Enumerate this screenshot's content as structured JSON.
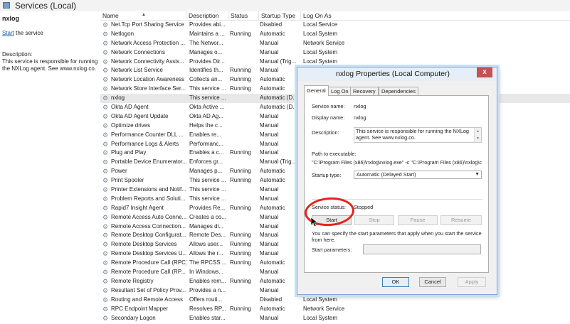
{
  "header": {
    "title": "Services (Local)"
  },
  "left_pane": {
    "service_name": "nxlog",
    "start_link": "Start",
    "start_suffix": " the service",
    "description_label": "Description:",
    "description_text": "This service is responsible for running the NXLog agent. See www.nxlog.co."
  },
  "columns": {
    "name": "Name",
    "description": "Description",
    "status": "Status",
    "startup_type": "Startup Type",
    "log_on_as": "Log On As"
  },
  "services": [
    {
      "name": "Net.Tcp Port Sharing Service",
      "description": "Provides abi...",
      "status": "",
      "startup": "Disabled",
      "logon": "Local Service"
    },
    {
      "name": "Netlogon",
      "description": "Maintains a ...",
      "status": "Running",
      "startup": "Automatic",
      "logon": "Local System"
    },
    {
      "name": "Network Access Protection ...",
      "description": "The Networ...",
      "status": "",
      "startup": "Manual",
      "logon": "Network Service"
    },
    {
      "name": "Network Connections",
      "description": "Manages o...",
      "status": "",
      "startup": "Manual",
      "logon": "Local System"
    },
    {
      "name": "Network Connectivity Assis...",
      "description": "Provides Dir...",
      "status": "",
      "startup": "Manual (Trig...",
      "logon": "Local System"
    },
    {
      "name": "Network List Service",
      "description": "Identifies th...",
      "status": "Running",
      "startup": "Manual",
      "logon": ""
    },
    {
      "name": "Network Location Awareness",
      "description": "Collects an...",
      "status": "Running",
      "startup": "Automatic",
      "logon": ""
    },
    {
      "name": "Network Store Interface Ser...",
      "description": "This service ...",
      "status": "Running",
      "startup": "Automatic",
      "logon": ""
    },
    {
      "name": "nxlog",
      "description": "This service ...",
      "status": "",
      "startup": "Automatic (D...",
      "logon": ""
    },
    {
      "name": "Okta AD Agent",
      "description": "Okta Active ...",
      "status": "",
      "startup": "Automatic (D...",
      "logon": ""
    },
    {
      "name": "Okta AD Agent Update",
      "description": "Okta AD Ag...",
      "status": "",
      "startup": "Manual",
      "logon": ""
    },
    {
      "name": "Optimize drives",
      "description": "Helps the c...",
      "status": "",
      "startup": "Manual",
      "logon": ""
    },
    {
      "name": "Performance Counter DLL ...",
      "description": "Enables re...",
      "status": "",
      "startup": "Manual",
      "logon": ""
    },
    {
      "name": "Performance Logs & Alerts",
      "description": "Performanc...",
      "status": "",
      "startup": "Manual",
      "logon": ""
    },
    {
      "name": "Plug and Play",
      "description": "Enables a c...",
      "status": "Running",
      "startup": "Manual",
      "logon": ""
    },
    {
      "name": "Portable Device Enumerator...",
      "description": "Enforces gr...",
      "status": "",
      "startup": "Manual (Trig...",
      "logon": ""
    },
    {
      "name": "Power",
      "description": "Manages p...",
      "status": "Running",
      "startup": "Automatic",
      "logon": ""
    },
    {
      "name": "Print Spooler",
      "description": "This service ...",
      "status": "Running",
      "startup": "Automatic",
      "logon": ""
    },
    {
      "name": "Printer Extensions and Notif...",
      "description": "This service ...",
      "status": "",
      "startup": "Manual",
      "logon": ""
    },
    {
      "name": "Problem Reports and Soluti...",
      "description": "This service ...",
      "status": "",
      "startup": "Manual",
      "logon": ""
    },
    {
      "name": "Rapid7 Insight Agent",
      "description": "Provides Re...",
      "status": "Running",
      "startup": "Automatic",
      "logon": ""
    },
    {
      "name": "Remote Access Auto Conne...",
      "description": "Creates a co...",
      "status": "",
      "startup": "Manual",
      "logon": ""
    },
    {
      "name": "Remote Access Connection...",
      "description": "Manages di...",
      "status": "",
      "startup": "Manual",
      "logon": ""
    },
    {
      "name": "Remote Desktop Configurat...",
      "description": "Remote Des...",
      "status": "Running",
      "startup": "Manual",
      "logon": ""
    },
    {
      "name": "Remote Desktop Services",
      "description": "Allows user...",
      "status": "Running",
      "startup": "Manual",
      "logon": ""
    },
    {
      "name": "Remote Desktop Services U...",
      "description": "Allows the r...",
      "status": "Running",
      "startup": "Manual",
      "logon": ""
    },
    {
      "name": "Remote Procedure Call (RPC)",
      "description": "The RPCSS ...",
      "status": "Running",
      "startup": "Automatic",
      "logon": ""
    },
    {
      "name": "Remote Procedure Call (RP...",
      "description": "In Windows...",
      "status": "",
      "startup": "Manual",
      "logon": ""
    },
    {
      "name": "Remote Registry",
      "description": "Enables rem...",
      "status": "Running",
      "startup": "Automatic",
      "logon": ""
    },
    {
      "name": "Resultant Set of Policy Prov...",
      "description": "Provides a n...",
      "status": "",
      "startup": "Manual",
      "logon": ""
    },
    {
      "name": "Routing and Remote Access",
      "description": "Offers routi...",
      "status": "",
      "startup": "Disabled",
      "logon": "Local System"
    },
    {
      "name": "RPC Endpoint Mapper",
      "description": "Resolves RP...",
      "status": "Running",
      "startup": "Automatic",
      "logon": "Network Service"
    },
    {
      "name": "Secondary Logon",
      "description": "Enables star...",
      "status": "",
      "startup": "Manual",
      "logon": "Local System"
    }
  ],
  "dialog": {
    "title": "nxlog Properties (Local Computer)",
    "close_label": "x",
    "tabs": [
      "General",
      "Log On",
      "Recovery",
      "Dependencies"
    ],
    "service_name_label": "Service name:",
    "service_name_value": "nxlog",
    "display_name_label": "Display name:",
    "display_name_value": "nxlog",
    "description_label": "Description:",
    "description_value": "This service is responsible for running the NXLog agent. See www.nxlog.co.",
    "path_label": "Path to executable:",
    "path_value": "\"C:\\Program Files (x86)\\nxlog\\nxlog.exe\" -c \"C:\\Program Files (x86)\\nxlog\\c",
    "startup_type_label": "Startup type:",
    "startup_type_value": "Automatic (Delayed Start)",
    "service_status_label": "Service status:",
    "service_status_value": "Stopped",
    "buttons": {
      "start": "Start",
      "stop": "Stop",
      "pause": "Pause",
      "resume": "Resume"
    },
    "hint_text": "You can specify the start parameters that apply when you start the service from here.",
    "start_params_label": "Start parameters:",
    "footer": {
      "ok": "OK",
      "cancel": "Cancel",
      "apply": "Apply"
    }
  },
  "colors": {
    "annotation_circle": "#e8221b",
    "dialog_border": "#7fa8d6",
    "close_button": "#c75050"
  }
}
